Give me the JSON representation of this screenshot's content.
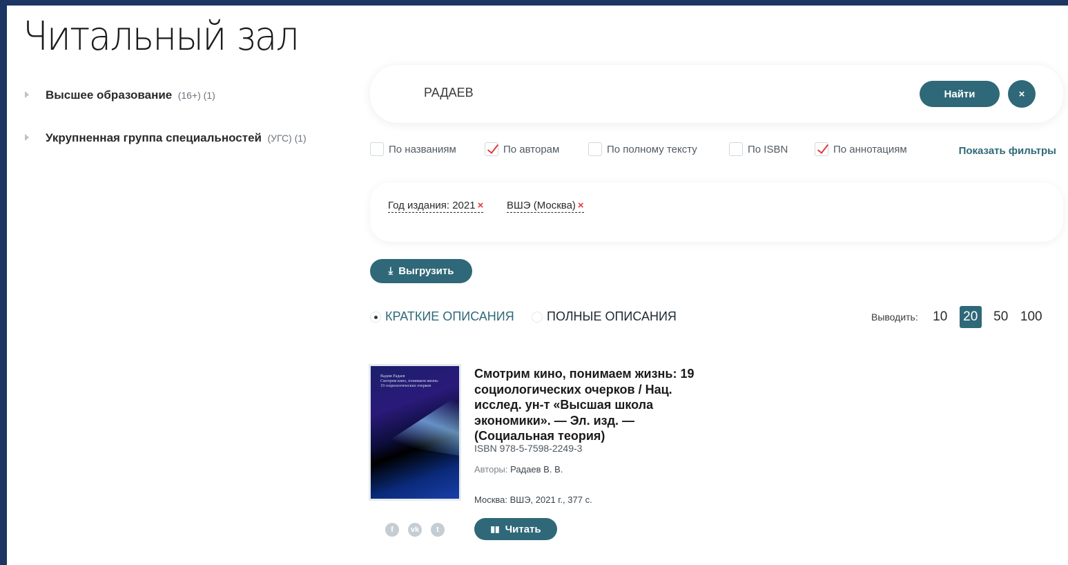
{
  "page": {
    "title": "Читальный зал"
  },
  "sidebar": {
    "items": [
      {
        "label": "Высшее образование",
        "meta": "(16+) (1)"
      },
      {
        "label": "Укрупненная группа специальностей",
        "meta": "(УГС) (1)"
      }
    ]
  },
  "search": {
    "value": "РАДАЕВ",
    "find_label": "Найти",
    "clear_label": "×"
  },
  "search_options": {
    "items": [
      {
        "label": "По названиям",
        "checked": false
      },
      {
        "label": "По авторам",
        "checked": true
      },
      {
        "label": "По полному тексту",
        "checked": false
      },
      {
        "label": "По ISBN",
        "checked": false
      },
      {
        "label": "По аннотациям",
        "checked": true
      }
    ],
    "show_filters_label": "Показать фильтры"
  },
  "active_filters": [
    {
      "label": "Год издания: 2021",
      "remove": "×"
    },
    {
      "label": "ВШЭ (Москва)",
      "remove": "×"
    }
  ],
  "export": {
    "label": "Выгрузить"
  },
  "view_mode": {
    "options": [
      {
        "label": "КРАТКИЕ ОПИСАНИЯ",
        "selected": true
      },
      {
        "label": "ПОЛНЫЕ ОПИСАНИЯ",
        "selected": false
      }
    ]
  },
  "per_page": {
    "label": "Выводить:",
    "options": [
      "10",
      "20",
      "50",
      "100"
    ],
    "selected": "20"
  },
  "results": [
    {
      "title": "Смотрим кино, понимаем жизнь: 19 социологических очерков / Нац. исслед. ун-т «Высшая школа экономики». — Эл. изд. — (Социальная теория)",
      "isbn": "ISBN 978-5-7598-2249-3",
      "authors_label": "Авторы:",
      "authors": "Радаев В. В.",
      "publication": "Москва: ВШЭ, 2021 г., 377 с.",
      "read_label": "Читать",
      "cover": {
        "author": "Вадим Радаев",
        "title": "Смотрим кино, понимаем жизнь:",
        "subtitle": "19 социологических очерков"
      }
    }
  ],
  "share": {
    "icons": [
      "facebook-icon",
      "vk-icon",
      "twitter-icon"
    ]
  },
  "colors": {
    "accent": "#2f6878",
    "frame": "#1c3563",
    "check": "#e23a3a"
  }
}
